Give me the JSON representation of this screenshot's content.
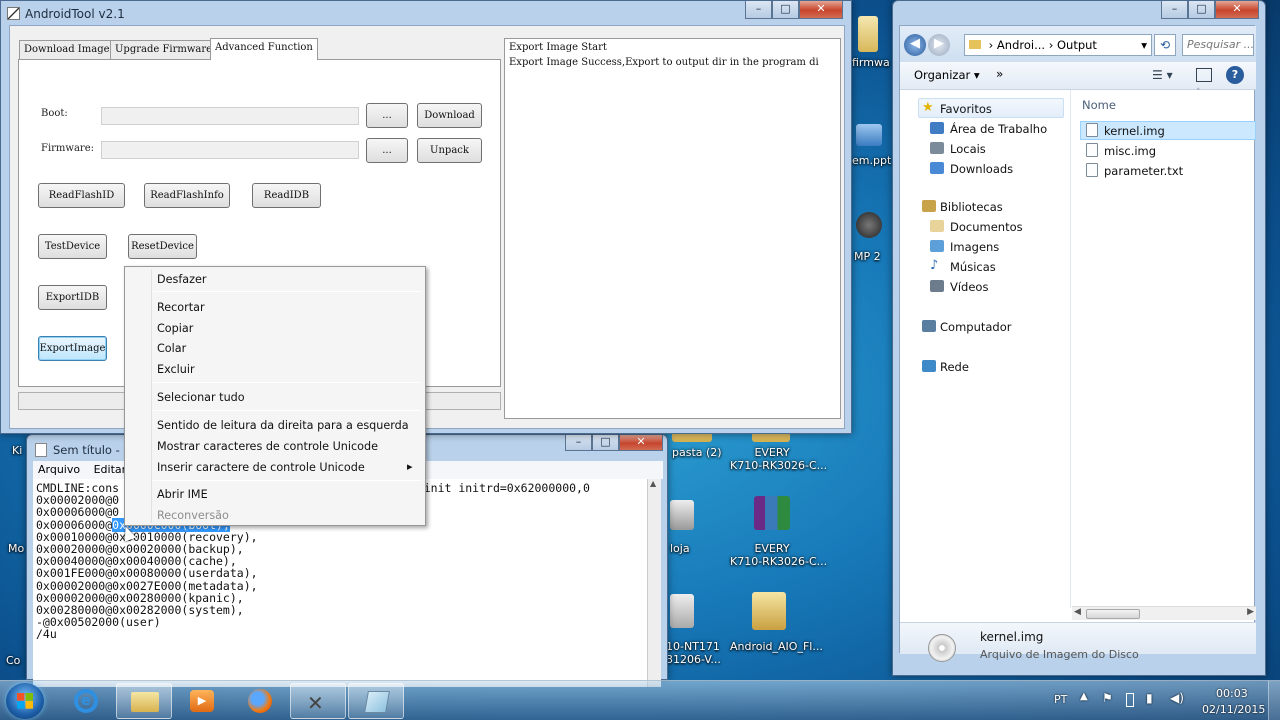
{
  "desktop": {
    "labels": [
      {
        "id": "firmw",
        "text": "firmwa"
      },
      {
        "id": "emppt",
        "text": "em.ppt"
      },
      {
        "id": "mp2",
        "text": "MP 2"
      },
      {
        "id": "pasta2",
        "text": "pasta (2)"
      },
      {
        "id": "every1",
        "line1": "EVERY",
        "line2": "K710-RK3026-C..."
      },
      {
        "id": "every2",
        "line1": "EVERY",
        "line2": "K710-RK3026-C..."
      },
      {
        "id": "loja",
        "text": "loja"
      },
      {
        "id": "nt171",
        "line1": "10-NT171",
        "line2": "31206-V..."
      },
      {
        "id": "aio",
        "text": "Android_AIO_Fl..."
      },
      {
        "id": "mo",
        "text": "Mo"
      },
      {
        "id": "co",
        "text": "Co"
      },
      {
        "id": "ki",
        "text": "Ki"
      }
    ]
  },
  "androidtool": {
    "title": "AndroidTool v2.1",
    "tabs": [
      "Download Image",
      "Upgrade Firmware",
      "Advanced Function"
    ],
    "boot_label": "Boot:",
    "firmware_label": "Firmware:",
    "browse_label": "...",
    "download_label": "Download",
    "unpack_label": "Unpack",
    "buttons": {
      "readflashid": "ReadFlashID",
      "readflashinfo": "ReadFlashInfo",
      "readidb": "ReadIDB",
      "testdevice": "TestDevice",
      "resetdevice": "ResetDevice",
      "exportidb": "ExportIDB",
      "exportimage": "ExportImage"
    },
    "log": [
      "Export Image Start",
      "Export Image Success,Export to output dir in the program di"
    ]
  },
  "notepad": {
    "title": "Sem título - Bloco de notas",
    "menu": [
      "Arquivo",
      "Editar"
    ],
    "lines": [
      "CMDLINE:cons                                      init=/init initrd=0x62000000,0",
      "0x00002000@0",
      "0x00006000@0",
      "0x00006000@",
      "0x00010000@0x00010000(recovery),",
      "0x00020000@0x00020000(backup),",
      "0x00040000@0x00040000(cache),",
      "0x001FE000@0x00080000(userdata),",
      "0x00002000@0x0027E000(metadata),",
      "0x00002000@0x00280000(kpanic),",
      "0x00280000@0x00282000(system),",
      "-@0x00502000(user)",
      "/4u"
    ],
    "selected_text": "0x0000C000(boot),"
  },
  "explorer": {
    "breadcrumb": [
      "Androi...",
      "Output"
    ],
    "search_placeholder": "Pesquisar ...",
    "organize_label": "Organizar ▾",
    "more_label": "»",
    "column_name": "Nome",
    "nav": {
      "favoritos": "Favoritos",
      "area_de_trabalho": "Área de Trabalho",
      "locais": "Locais",
      "downloads": "Downloads",
      "bibliotecas": "Bibliotecas",
      "documentos": "Documentos",
      "imagens": "Imagens",
      "musicas": "Músicas",
      "videos": "Vídeos",
      "computador": "Computador",
      "rede": "Rede"
    },
    "files": [
      "kernel.img",
      "misc.img",
      "parameter.txt"
    ],
    "details": {
      "name": "kernel.img",
      "type": "Arquivo de Imagem do Disco"
    }
  },
  "context_menu": {
    "items": {
      "desfazer": "Desfazer",
      "recortar": "Recortar",
      "copiar": "Copiar",
      "colar": "Colar",
      "excluir": "Excluir",
      "selecionar_tudo": "Selecionar tudo",
      "rtl": "Sentido de leitura da direita para a esquerda",
      "mostrar_unicode": "Mostrar caracteres de controle Unicode",
      "inserir_unicode": "Inserir caractere de controle Unicode",
      "abrir_ime": "Abrir IME",
      "reconversao": "Reconversão"
    },
    "submenu_arrow": "▸"
  },
  "taskbar": {
    "language": "PT",
    "time": "00:03",
    "date": "02/11/2015"
  },
  "colors": {
    "selection": "#3399ff",
    "context_bg": "#f5f5f5",
    "explorer_selection": "#cce8ff"
  }
}
